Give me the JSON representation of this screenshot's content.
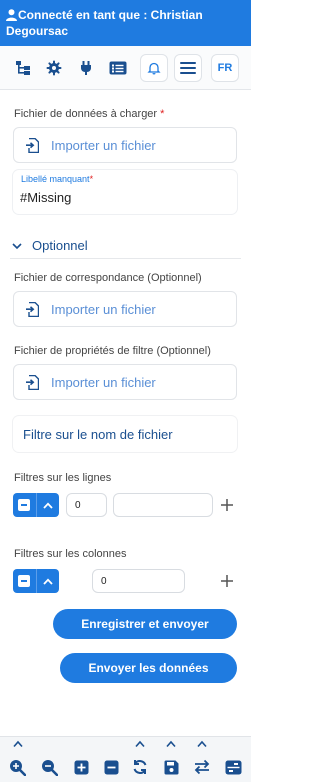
{
  "header": {
    "title": "Connecté en tant que : Christian Degoursac"
  },
  "toolbar": {
    "icons": [
      "hierarchy-icon",
      "gear-icon",
      "plug-icon",
      "list-icon",
      "bell-icon",
      "menu-icon"
    ],
    "lang": "FR"
  },
  "form": {
    "data_file": {
      "label": "Fichier de données à charger",
      "required_mark": "*",
      "button": "Importer un fichier"
    },
    "missing": {
      "label": "Libellé manquant",
      "required_mark": "*",
      "value": "#Missing"
    },
    "optional_toggle": "Optionnel",
    "mapping_file": {
      "label": "Fichier de correspondance (Optionnel)",
      "button": "Importer un fichier"
    },
    "filter_props_file": {
      "label": "Fichier de propriétés de filtre (Optionnel)",
      "button": "Importer un fichier"
    },
    "filename_filter": "Filtre sur le nom de fichier",
    "row_filters": {
      "label": "Filtres sur les lignes",
      "value": "0",
      "text": ""
    },
    "col_filters": {
      "label": "Filtres sur les colonnes",
      "value": "0"
    }
  },
  "actions": {
    "save_send": "Enregistrer et envoyer",
    "send_data": "Envoyer les données"
  },
  "colors": {
    "primary": "#1f7be0",
    "header": "#1f7be0",
    "required": "#e02020"
  }
}
